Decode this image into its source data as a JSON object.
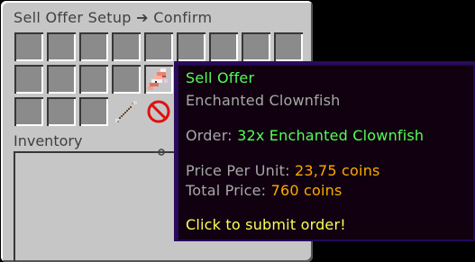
{
  "window": {
    "title_left": "Sell Offer Setup",
    "title_arrow": "➔",
    "title_right": "Confirm",
    "inventory_label": "Inventory"
  },
  "tooltip": {
    "title": "Sell Offer",
    "item_name": "Enchanted Clownfish",
    "order_label": "Order:",
    "order_value": "32x Enchanted Clownfish",
    "price_per_unit_label": "Price Per Unit:",
    "price_per_unit_value": "23,75 coins",
    "total_price_label": "Total Price:",
    "total_price_value": "760 coins",
    "action": "Click to submit order!"
  },
  "colors": {
    "tooltip_bg": "#100010",
    "tooltip_border": "#2a0b5a",
    "green": "#55ff55",
    "gray": "#a8a8a8",
    "gold": "#ffaa00",
    "yellow": "#ffff55"
  },
  "icons": {
    "slot_fish": "enchanted-clownfish-icon",
    "slot_arrow": "back-arrow-icon",
    "slot_barrier": "cancel-barrier-icon"
  }
}
